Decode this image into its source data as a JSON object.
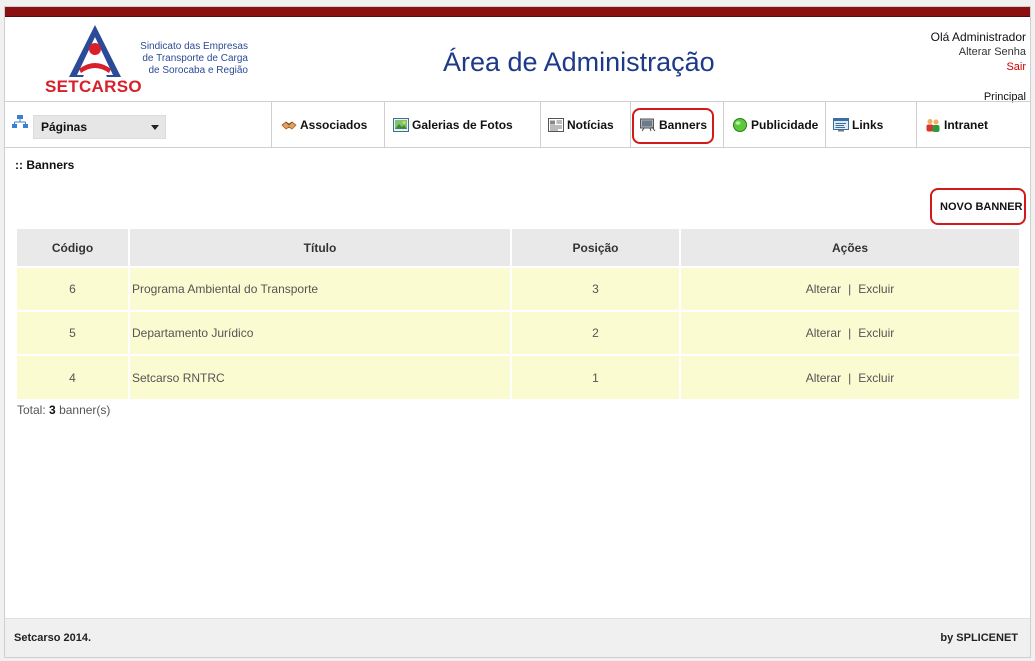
{
  "header": {
    "logo_name": "SETCARSO",
    "logo_tagline": [
      "Sindicato das Empresas",
      "de Transporte de Carga",
      "de Sorocaba e Região"
    ],
    "title": "Área de Administração",
    "greeting": "Olá Administrador",
    "change_password": "Alterar Senha",
    "logout": "Sair",
    "principal_link": "Principal"
  },
  "nav": {
    "pages_select_value": "Páginas",
    "items": [
      {
        "label": "Associados",
        "icon": "handshake-icon"
      },
      {
        "label": "Galerias de Fotos",
        "icon": "photo-gallery-icon"
      },
      {
        "label": "Notícias",
        "icon": "news-icon"
      },
      {
        "label": "Banners",
        "icon": "banner-icon"
      },
      {
        "label": "Publicidade",
        "icon": "green-globe-icon"
      },
      {
        "label": "Links",
        "icon": "links-icon"
      },
      {
        "label": "Intranet",
        "icon": "users-icon"
      }
    ]
  },
  "breadcrumb": ":: Banners",
  "new_button": "NOVO BANNER",
  "table": {
    "columns": [
      "Código",
      "Título",
      "Posição",
      "Ações"
    ],
    "rows": [
      {
        "code": "6",
        "title": "Programa Ambiental do Transporte",
        "position": "3",
        "edit": "Alterar",
        "sep": "|",
        "delete": "Excluir"
      },
      {
        "code": "5",
        "title": "Departamento Jurídico",
        "position": "2",
        "edit": "Alterar",
        "sep": "|",
        "delete": "Excluir"
      },
      {
        "code": "4",
        "title": "Setcarso RNTRC",
        "position": "1",
        "edit": "Alterar",
        "sep": "|",
        "delete": "Excluir"
      }
    ]
  },
  "total": {
    "prefix": "Total:",
    "count": "3",
    "suffix": "banner(s)"
  },
  "footer": {
    "left": "Setcarso 2014.",
    "right": "by SPLICENET"
  },
  "colors": {
    "topbar": "#8b1111",
    "title_blue": "#1d3a8a",
    "row_yellow": "#fbfbd2",
    "highlight_red": "#d21a1a"
  }
}
